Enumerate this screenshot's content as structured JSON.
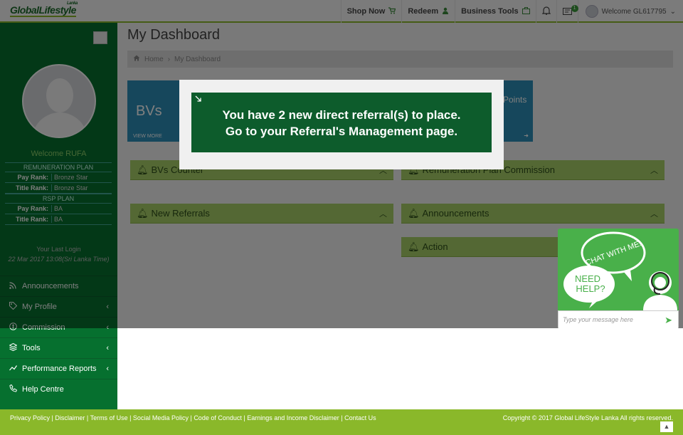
{
  "header": {
    "logo": {
      "text": "GlobalLifestyle",
      "tag": "Lanka"
    },
    "nav": [
      {
        "label": "Shop Now",
        "icon": "cart-icon"
      },
      {
        "label": "Redeem",
        "icon": "user-icon"
      },
      {
        "label": "Business Tools",
        "icon": "briefcase-icon"
      }
    ],
    "notification_badge": "1",
    "welcome_text": "Welcome GL617795"
  },
  "sidebar": {
    "welcome": "Welcome RUFA",
    "remuneration_plan": {
      "heading": "REMUNERATION PLAN",
      "pay_rank_label": "Pay Rank:",
      "pay_rank": "Bronze Star",
      "title_rank_label": "Title Rank:",
      "title_rank": "Bronze Star"
    },
    "rsp_plan": {
      "heading": "RSP PLAN",
      "pay_rank_label": "Pay Rank:",
      "pay_rank": "BA",
      "title_rank_label": "Title Rank:",
      "title_rank": "BA"
    },
    "last_login_label": "Your Last Login",
    "last_login_time": "22 Mar 2017 13:08(Sri Lanka Time)",
    "menu": [
      {
        "label": "Announcements",
        "icon": "rss-icon"
      },
      {
        "label": "My Profile",
        "icon": "tag-icon"
      },
      {
        "label": "Commission",
        "icon": "money-icon"
      },
      {
        "label": "Tools",
        "icon": "layers-icon"
      },
      {
        "label": "Performance Reports",
        "icon": "chart-icon"
      },
      {
        "label": "Help Centre",
        "icon": "phone-icon"
      }
    ]
  },
  "main": {
    "title": "My Dashboard",
    "breadcrumb": [
      "Home",
      "My Dashboard"
    ],
    "cards": {
      "bvs": "BVs",
      "bvs_more": "VIEW MORE",
      "points": "Points"
    },
    "panels": {
      "bvs_counter": "BVs Counter",
      "remuneration": "Remuneration Plan Commission",
      "new_referrals": "New Referrals",
      "announcements": "Announcements",
      "action": "Action"
    }
  },
  "modal": {
    "line1": "You have 2 new direct referral(s) to place.",
    "line2": "Go to your Referral's Management page."
  },
  "chat": {
    "bubble1": "CHAT WITH ME!",
    "bubble2a": "NEED",
    "bubble2b": "HELP?",
    "placeholder": "Type your message here"
  },
  "footer": {
    "links": [
      "Privacy Policy",
      "Disclaimer",
      "Terms of Use",
      "Social Media Policy",
      "Code of Conduct",
      "Earnings and Income Disclaimer",
      "Contact Us"
    ],
    "copyright": "Copyright © 2017 Global LifeStyle Lanka All rights reserved."
  },
  "colors": {
    "brand_green": "#06702f",
    "accent_green": "#8ab82a",
    "panel_green": "#a8d168",
    "modal_green": "#0d5c2c"
  }
}
